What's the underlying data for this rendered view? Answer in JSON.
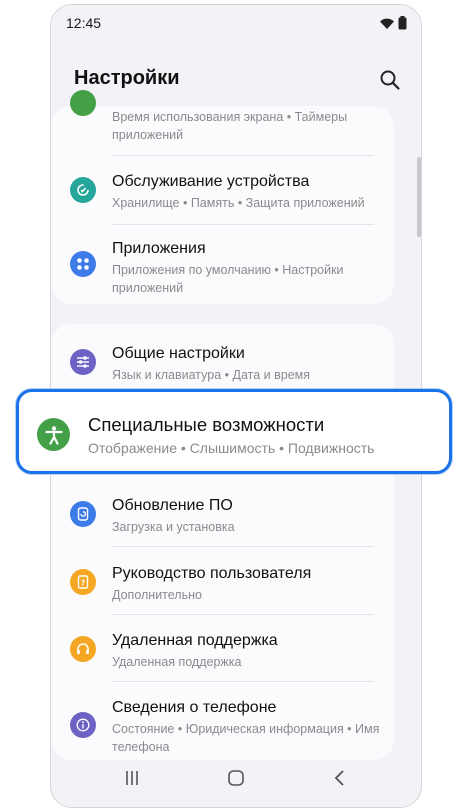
{
  "status_bar": {
    "time": "12:45"
  },
  "header": {
    "title": "Настройки"
  },
  "card1": {
    "partial_item": {
      "subtitle": "Время использования экрана • Таймеры приложений",
      "icon": "digital-wellbeing-icon",
      "color": "#43a047"
    },
    "items": [
      {
        "title": "Обслуживание устройства",
        "subtitle": "Хранилище • Память • Защита приложений",
        "icon": "device-care-icon",
        "color": "#26a69a"
      },
      {
        "title": "Приложения",
        "subtitle": "Приложения по умолчанию • Настройки приложений",
        "icon": "apps-icon",
        "color": "#3d7be8"
      }
    ]
  },
  "card2": {
    "items": [
      {
        "title": "Общие настройки",
        "subtitle": "Язык и клавиатура • Дата и время",
        "icon": "sliders-icon",
        "color": "#6b62c4"
      },
      {
        "title": "Обновление ПО",
        "subtitle": "Загрузка и установка",
        "icon": "software-update-icon",
        "color": "#3d7be8"
      },
      {
        "title": "Руководство пользователя",
        "subtitle": "Дополнительно",
        "icon": "user-manual-icon",
        "color": "#f5a623"
      },
      {
        "title": "Удаленная поддержка",
        "subtitle": "Удаленная поддержка",
        "icon": "headset-icon",
        "color": "#f5a623"
      },
      {
        "title": "Сведения о телефоне",
        "subtitle": "Состояние • Юридическая информация • Имя телефона",
        "icon": "info-icon",
        "color": "#6b62c4"
      }
    ]
  },
  "highlighted_item": {
    "title": "Специальные возможности",
    "subtitle": "Отображение • Слышимость • Подвижность",
    "icon": "accessibility-icon",
    "color": "#43a047",
    "highlight_color": "#1a73e8"
  },
  "navbar": {
    "recent": "recent-apps-icon",
    "home": "home-icon",
    "back": "back-icon"
  }
}
